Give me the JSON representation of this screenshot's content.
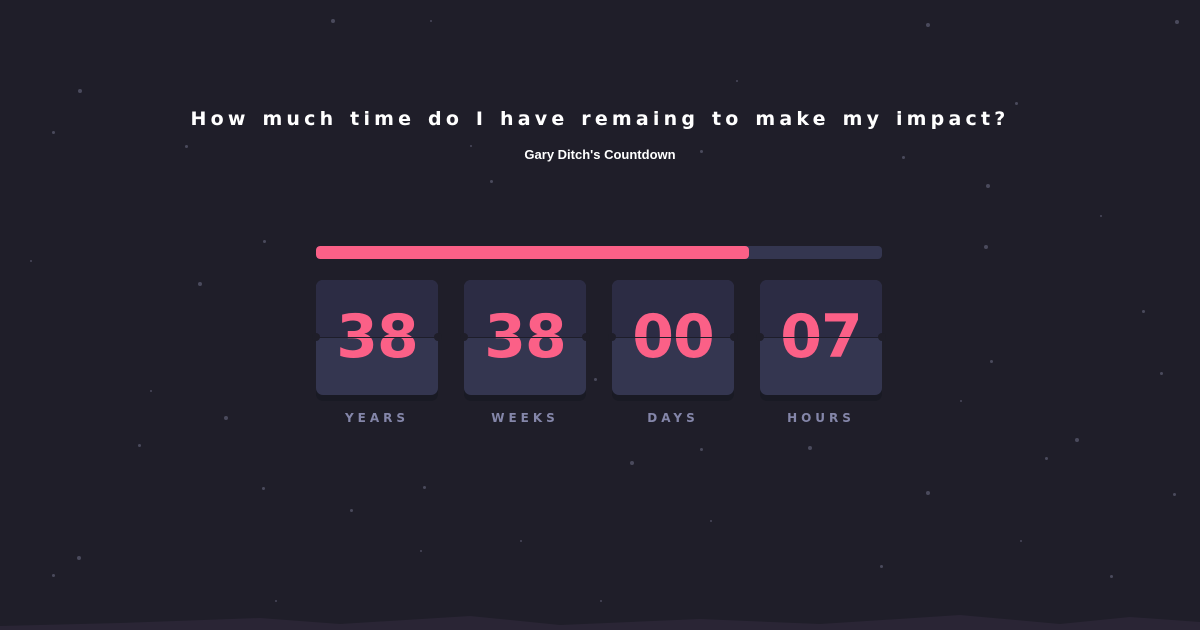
{
  "header": {
    "title": "How much time do I have remaing to make my impact?",
    "subtitle": "Gary Ditch's Countdown"
  },
  "progress": {
    "fraction": 0.765,
    "fill_color": "#fb6087",
    "track_color": "#343650"
  },
  "countdown": [
    {
      "value": "38",
      "label": "YEARS"
    },
    {
      "value": "38",
      "label": "WEEKS"
    },
    {
      "value": "00",
      "label": "DAYS"
    },
    {
      "value": "07",
      "label": "HOURS"
    }
  ],
  "colors": {
    "background": "#1f1e29",
    "accent": "#fb6087",
    "card": "#343650",
    "label": "#8486a9"
  }
}
